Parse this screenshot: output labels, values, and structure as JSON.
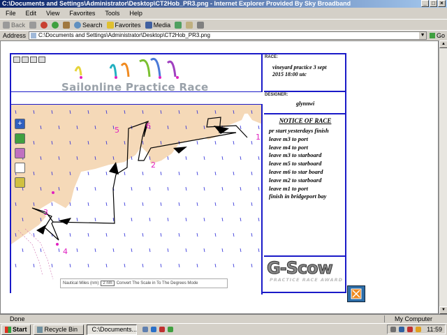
{
  "window": {
    "title": "C:\\Documents and Settings\\Administrator\\Desktop\\CT2Hob_PR3.png - Internet Explorer Provided By Sky Broadband"
  },
  "menu": [
    "File",
    "Edit",
    "View",
    "Favorites",
    "Tools",
    "Help"
  ],
  "toolbar": {
    "back": "Back",
    "search": "Search",
    "favorites": "Favorites",
    "media": "Media"
  },
  "address": {
    "label": "Address",
    "value": "C:\\Documents and Settings\\Administrator\\Desktop\\CT2Hob_PR3.png",
    "go": "Go"
  },
  "race_page": {
    "title": "Sailonline Practice Race",
    "race_label": "RACE:",
    "race_name": "vineyard practice 3 sept",
    "race_time": "2015 18:00 utc",
    "designer_label": "DESIGNER:",
    "designer": "glynnwi",
    "notice_title": "NOTICE OF RACE",
    "notice_items": [
      "pr start yesterdays finish",
      "leave m3 to port",
      "leave m4 to port",
      "leave m3 to starboard",
      "leave m5 to starboard",
      "leave m6 to star board",
      "leave m2 to starboard",
      "leave m1 to port",
      "finish in bridgeport bay"
    ],
    "logo_main": "G-Scow",
    "logo_sub": "PRACTICE RACE AWARD",
    "marks": [
      "1",
      "2",
      "3",
      "4",
      "5",
      "6"
    ],
    "scale_text": "Nautical Miles (nm)",
    "scale_value": "2 nm",
    "scale_note": "Convert The Scale in To The Degrees Mode"
  },
  "status": {
    "left": "Done",
    "right": "My Computer"
  },
  "taskbar": {
    "start": "Start",
    "tasks": [
      "Recycle Bin",
      "C:\\Documents..."
    ],
    "clock": "11:59"
  },
  "colors": {
    "border_blue": "#1a1ac8",
    "land": "#f5d9b8",
    "mark_magenta": "#e020c0",
    "wind_arrow": "#2a2ad8"
  }
}
